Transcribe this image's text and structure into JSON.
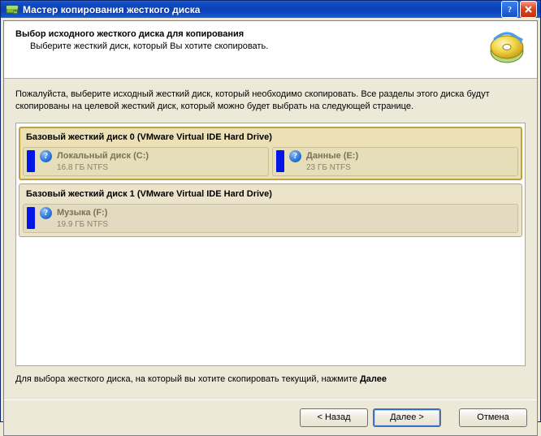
{
  "window": {
    "title": "Мастер копирования жесткого диска"
  },
  "header": {
    "heading": "Выбор исходного жесткого диска для копирования",
    "sub": "Выберите жесткий диск, который Вы хотите скопировать."
  },
  "intro": "Пожалуйста, выберите исходный жесткий диск, который необходимо скопировать. Все разделы этого диска будут скопированы на целевой жесткий диск, который можно будет выбрать на следующей странице.",
  "disks": [
    {
      "selected": true,
      "title": "Базовый жесткий диск 0 (VMware Virtual IDE Hard Drive)",
      "partitions": [
        {
          "name": "Локальный диск (C:)",
          "meta": "16.8 ГБ NTFS"
        },
        {
          "name": "Данные (E:)",
          "meta": "23 ГБ NTFS"
        }
      ]
    },
    {
      "selected": false,
      "title": "Базовый жесткий диск 1 (VMware Virtual IDE Hard Drive)",
      "partitions": [
        {
          "name": "Музыка (F:)",
          "meta": "19.9 ГБ NTFS"
        }
      ]
    }
  ],
  "footer": {
    "hint_prefix": "Для выбора жесткого диска, на который вы хотите скопировать текущий, нажмите ",
    "hint_bold": "Далее"
  },
  "buttons": {
    "back": "< Назад",
    "next": "Далее >",
    "cancel": "Отмена"
  }
}
